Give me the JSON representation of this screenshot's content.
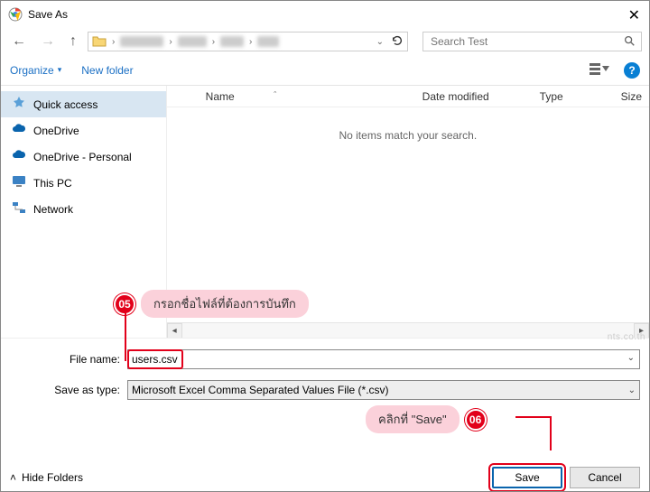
{
  "window": {
    "title": "Save As"
  },
  "nav": {
    "search_placeholder": "Search Test"
  },
  "toolbar": {
    "organize": "Organize",
    "newfolder": "New folder"
  },
  "sidebar": {
    "items": [
      {
        "label": "Quick access"
      },
      {
        "label": "OneDrive"
      },
      {
        "label": "OneDrive - Personal"
      },
      {
        "label": "This PC"
      },
      {
        "label": "Network"
      }
    ]
  },
  "columns": {
    "name": "Name",
    "date": "Date modified",
    "type": "Type",
    "size": "Size"
  },
  "main": {
    "empty": "No items match your search."
  },
  "form": {
    "filename_label": "File name:",
    "filename_value": "users.csv",
    "saveastype_label": "Save as type:",
    "saveastype_value": "Microsoft Excel Comma Separated Values File (*.csv)"
  },
  "buttons": {
    "hidefolders": "Hide Folders",
    "save": "Save",
    "cancel": "Cancel"
  },
  "annotations": {
    "a05": {
      "num": "05",
      "text": "กรอกชื่อไฟล์ที่ต้องการบันทึก"
    },
    "a06": {
      "num": "06",
      "text": "คลิกที่ \"Save\""
    }
  },
  "watermark": "nts.co.th"
}
